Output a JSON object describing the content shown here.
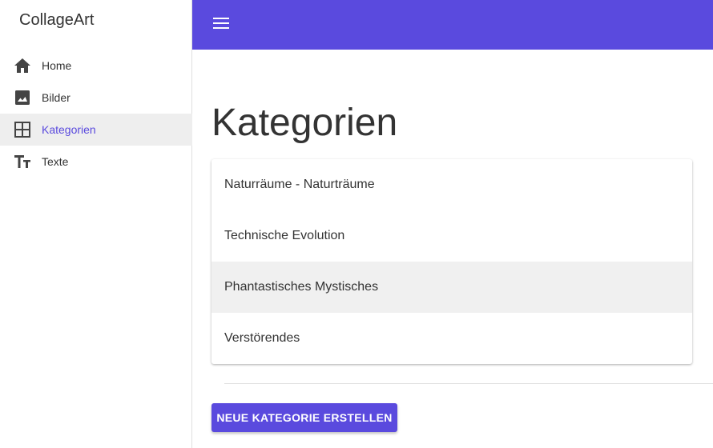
{
  "app": {
    "title": "CollageArt"
  },
  "sidebar": {
    "items": [
      {
        "label": "Home",
        "icon": "home-icon",
        "active": false
      },
      {
        "label": "Bilder",
        "icon": "image-icon",
        "active": false
      },
      {
        "label": "Kategorien",
        "icon": "grid-icon",
        "active": true
      },
      {
        "label": "Texte",
        "icon": "text-fields-icon",
        "active": false
      }
    ]
  },
  "topbar": {
    "menu_icon": "hamburger-menu-icon"
  },
  "main": {
    "title": "Kategorien",
    "categories": [
      "Naturräume - Naturträume",
      "Technische Evolution",
      "Phantastisches Mystisches",
      "Verstörendes"
    ],
    "create_button": "NEUE KATEGORIE ERSTELLEN"
  },
  "colors": {
    "primary": "#5a4ade",
    "active_bg": "#eeeeee",
    "hover_bg": "#f0f0f0",
    "text": "#333333"
  }
}
